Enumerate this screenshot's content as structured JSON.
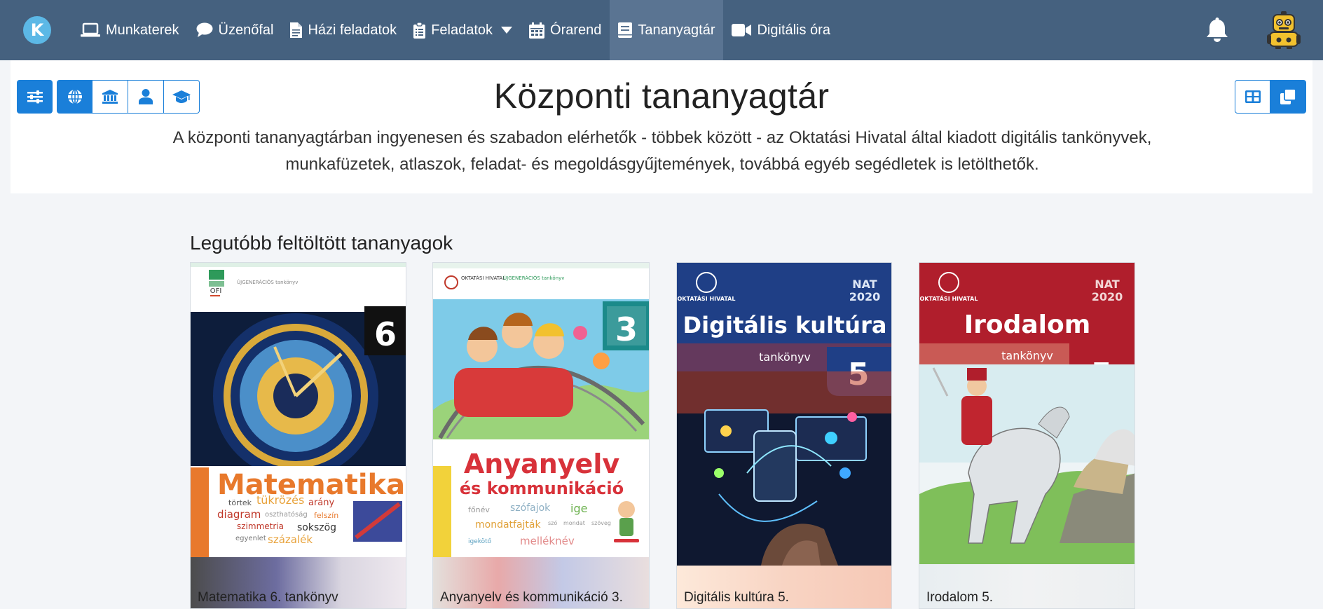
{
  "nav": {
    "brand_letter": "K",
    "items": [
      {
        "label": "Munkaterek",
        "icon": "laptop-icon"
      },
      {
        "label": "Üzenőfal",
        "icon": "comment-icon"
      },
      {
        "label": "Házi feladatok",
        "icon": "file-icon"
      },
      {
        "label": "Feladatok",
        "icon": "clipboard-icon",
        "dropdown": true
      },
      {
        "label": "Órarend",
        "icon": "calendar-icon"
      },
      {
        "label": "Tananyagtár",
        "icon": "book-icon",
        "active": true
      },
      {
        "label": "Digitális óra",
        "icon": "video-icon"
      }
    ],
    "notification_icon": "bell-icon",
    "avatar_icon": "robot-avatar-icon"
  },
  "header": {
    "title": "Központi tananyagtár",
    "description": "A központi tananyagtárban ingyenesen és szabadon elérhetők - többek között - az Oktatási Hivatal által kiadott digitális tankönyvek, munkafüzetek, atlaszok, feladat- és megoldásgyűjtemények, továbbá egyéb segédletek is letölthetők.",
    "filter_buttons": [
      "sliders-icon",
      "globe-icon",
      "institution-icon",
      "user-icon",
      "graduation-cap-icon"
    ],
    "view_buttons": [
      "grid-view-icon",
      "copy-view-icon"
    ]
  },
  "colors": {
    "navbar": "#45617f",
    "navbar_active": "#5a7492",
    "accent": "#1a7fd9"
  },
  "section": {
    "title": "Legutóbb feltöltött tananyagok"
  },
  "books": [
    {
      "title": "Matematika 6. tankönyv",
      "cover": {
        "top_label": "ÚJGENERÁCIÓS tankönyv",
        "publisher": "OFI",
        "grade": "6",
        "subject": "Matematika",
        "words": [
          "törtek",
          "tükrözés",
          "arány",
          "diagram",
          "oszthatóság",
          "felszín",
          "szimmetria",
          "sokszög",
          "egyenlet",
          "százalék"
        ]
      }
    },
    {
      "title": "Anyanyelv és kommunikáció 3.",
      "cover": {
        "publisher": "OKTATÁSI HIVATAL",
        "top_label": "ÚJGENERÁCIÓS tankönyv",
        "grade": "3",
        "subject_line1": "Anyanyelv",
        "subject_line2": "és kommunikáció",
        "words": [
          "főnév",
          "szófajok",
          "ige",
          "mondatfajták",
          "szó",
          "mondat",
          "szöveg",
          "igekötő",
          "melléknév"
        ]
      }
    },
    {
      "title": "Digitális kultúra 5.",
      "cover": {
        "publisher": "OKTATÁSI HIVATAL",
        "nat_line1": "NAT",
        "nat_line2": "2020",
        "subject": "Digitális kultúra",
        "book_type": "tankönyv",
        "grade": "5"
      }
    },
    {
      "title": "Irodalom 5.",
      "cover": {
        "publisher": "OKTATÁSI HIVATAL",
        "nat_line1": "NAT",
        "nat_line2": "2020",
        "subject": "Irodalom",
        "book_type": "tankönyv",
        "grade": "5"
      }
    }
  ]
}
